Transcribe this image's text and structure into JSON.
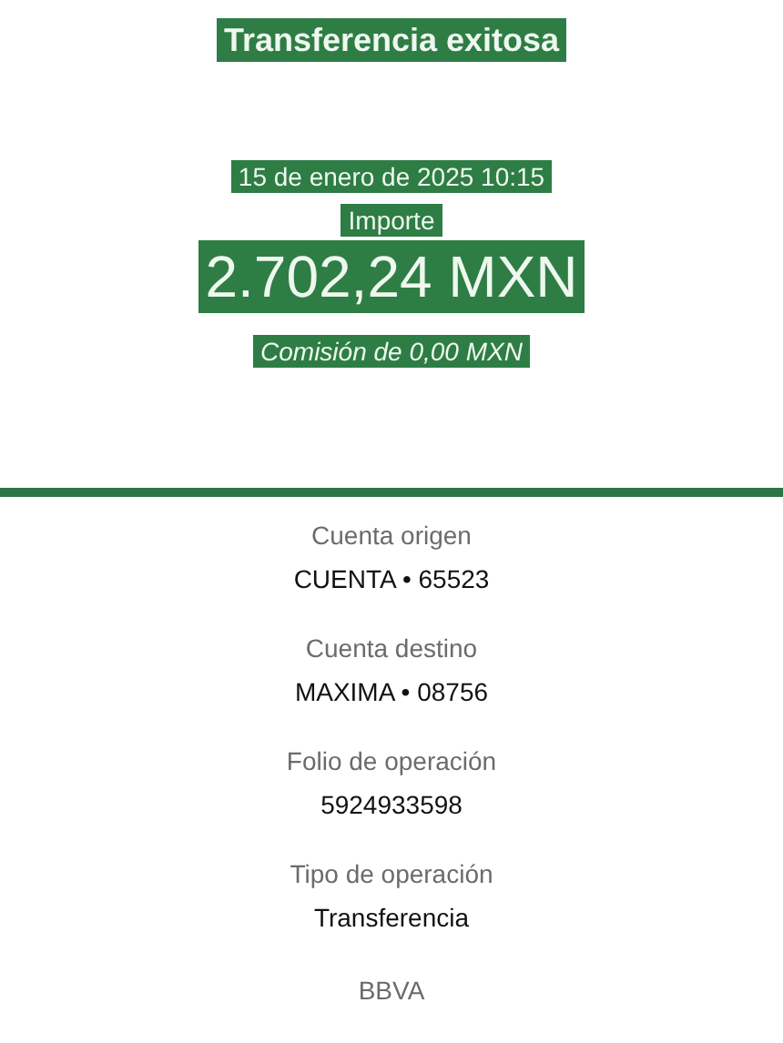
{
  "header": {
    "title": "Transferencia exitosa",
    "date": "15 de enero de 2025 10:15",
    "amount_label": "Importe",
    "amount": "2.702,24 MXN",
    "fee": "Comisión de 0,00 MXN"
  },
  "details": [
    {
      "label": "Cuenta origen",
      "value": "CUENTA • 65523"
    },
    {
      "label": "Cuenta destino",
      "value": "MAXIMA • 08756"
    },
    {
      "label": "Folio de operación",
      "value": "5924933598"
    },
    {
      "label": "Tipo de operación",
      "value": "Transferencia"
    }
  ],
  "footer": "BBVA"
}
